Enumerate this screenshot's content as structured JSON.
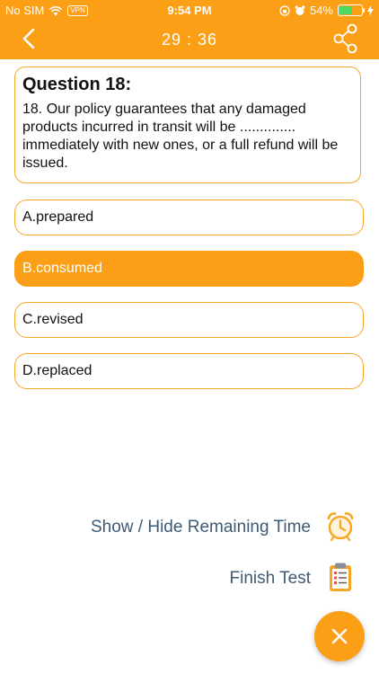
{
  "status_bar": {
    "carrier": "No SIM",
    "vpn": "VPN",
    "time": "9:54 PM",
    "battery": "54%",
    "battery_level": 0.54
  },
  "nav": {
    "timer": "29 : 36"
  },
  "question": {
    "title": "Question 18:",
    "text": "18. Our policy guarantees that any damaged products incurred in transit will be .............. immediately with new ones, or a full refund will be issued."
  },
  "options": [
    {
      "label": "A.prepared",
      "selected": false
    },
    {
      "label": "B.consumed",
      "selected": true
    },
    {
      "label": "C.revised",
      "selected": false
    },
    {
      "label": "D.replaced",
      "selected": false
    }
  ],
  "actions": {
    "toggle_time": "Show / Hide Remaining Time",
    "finish": "Finish Test"
  },
  "colors": {
    "accent": "#fa9f16",
    "action_text": "#3d5a74"
  }
}
